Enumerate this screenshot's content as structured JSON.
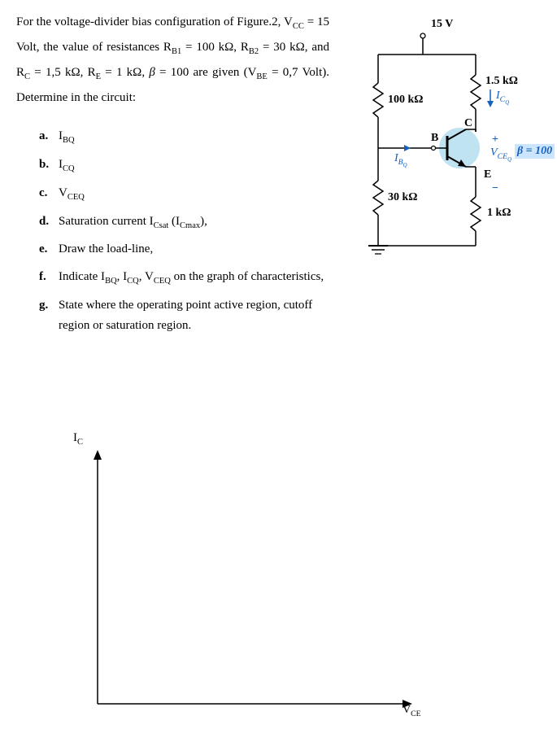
{
  "problem": {
    "line1": "For the voltage-divider bias configuration of Figure.2, V",
    "line1_sub": "CC",
    "line1_after": " = 15 Volt, the value of",
    "line2_a": "resistances R",
    "line2_b": " = 100 kΩ, R",
    "line2_c": " = 30 kΩ, and R",
    "line2_d": " = 1,5 kΩ, R",
    "line2_e": " = 1 kΩ, ",
    "line2_beta": "β",
    "line2_f": " = 100 are given (V",
    "line2_g": " = 0,7",
    "line3": "Volt). Determine in the circuit:"
  },
  "items": {
    "a": "I",
    "a_sub": "BQ",
    "b": "I",
    "b_sub": "CQ",
    "c": "V",
    "c_sub": "CEQ",
    "d_pre": "Saturation current I",
    "d_sub1": "Csat",
    "d_mid": " (I",
    "d_sub2": "Cmax",
    "d_post": "),",
    "e": "Draw the load-line,",
    "f_pre": "Indicate I",
    "f_sub1": "BQ",
    "f_mid1": ", I",
    "f_sub2": "CQ",
    "f_mid2": ", V",
    "f_sub3": "CEQ",
    "f_post": " on the graph of characteristics,",
    "g": "State where the operating point active region, cutoff region or saturation region."
  },
  "circuit": {
    "vcc": "15 V",
    "rb1": "100 kΩ",
    "rb2": "30 kΩ",
    "rc": "1.5 kΩ",
    "re": "1 kΩ",
    "ibq_pre": "I",
    "ibq_sub": "B",
    "ibq_sub2": "Q",
    "icq_pre": "I",
    "icq_sub": "C",
    "icq_sub2": "Q",
    "vceq_pre": "V",
    "vceq_sub": "CE",
    "vceq_sub2": "Q",
    "beta": "β = 100",
    "nodeB": "B",
    "nodeC": "C",
    "nodeE": "E",
    "plus": "+",
    "minus": "−"
  },
  "axes": {
    "y": "I",
    "y_sub": "C",
    "x": "V",
    "x_sub": "CE"
  }
}
